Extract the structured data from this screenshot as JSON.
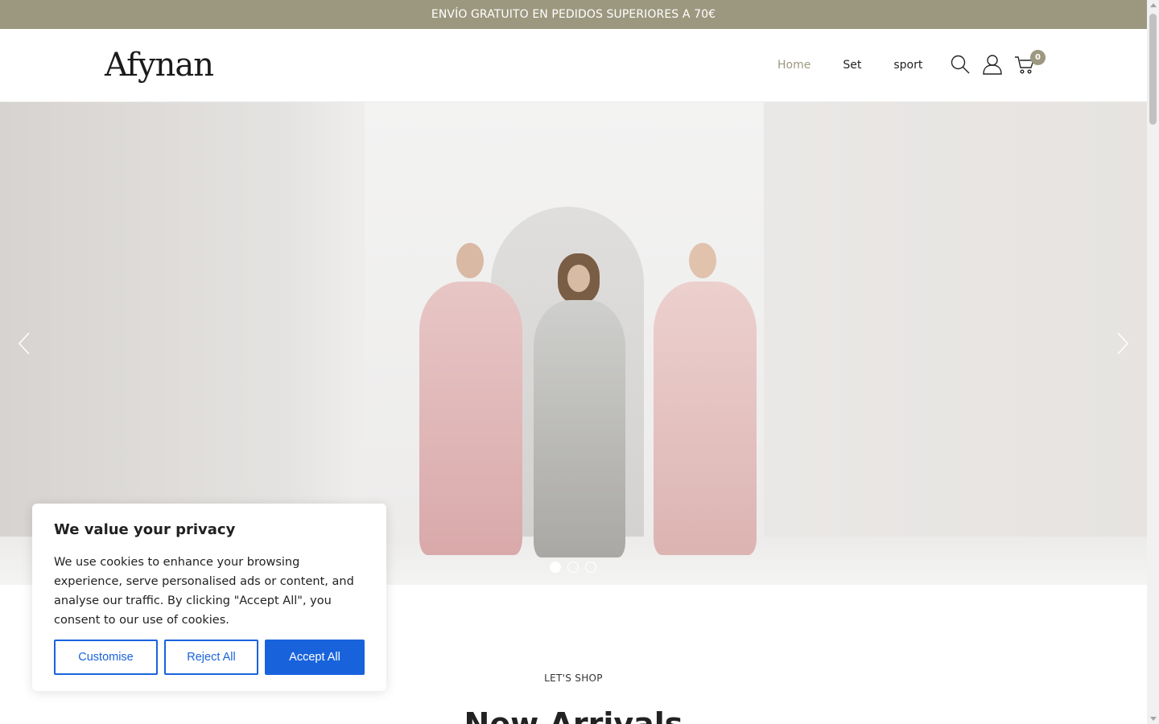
{
  "announcement": "ENVÍO GRATUITO EN PEDIDOS SUPERIORES A 70€",
  "header": {
    "logo": "Afynan",
    "nav": [
      {
        "label": "Home",
        "active": true
      },
      {
        "label": "Set",
        "active": false
      },
      {
        "label": "sport",
        "active": false
      }
    ],
    "icons": [
      "search-icon",
      "account-icon",
      "cart-icon"
    ],
    "cart_count": "0"
  },
  "hero": {
    "slides": 3,
    "active_slide": 1,
    "prev_icon": "chevron-left-icon",
    "next_icon": "chevron-right-icon"
  },
  "section": {
    "eyebrow": "LET'S SHOP",
    "title": "New Arrivals"
  },
  "cookie": {
    "title": "We value your privacy",
    "body": "We use cookies to enhance your browsing experience, serve personalised ads or content, and analyse our traffic. By clicking \"Accept All\", you consent to our use of cookies.",
    "customise": "Customise",
    "reject": "Reject All",
    "accept": "Accept All"
  },
  "colors": {
    "accent": "#9c987f",
    "cookie_primary": "#1863dc"
  }
}
